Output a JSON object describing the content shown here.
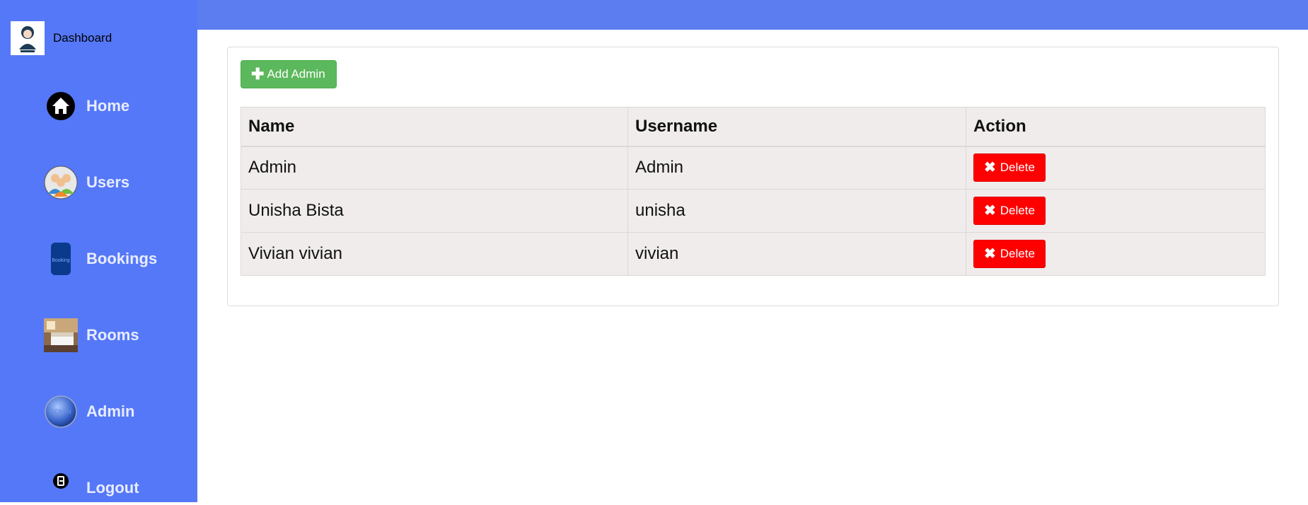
{
  "sidebar": {
    "brand": {
      "title": "Dashboard",
      "logo_icon": "admin-avatar-icon"
    },
    "items": [
      {
        "label": "Home",
        "icon": "home-icon"
      },
      {
        "label": "Users",
        "icon": "users-icon"
      },
      {
        "label": "Bookings",
        "icon": "booking-icon"
      },
      {
        "label": "Rooms",
        "icon": "room-photo-icon"
      },
      {
        "label": "Admin",
        "icon": "admin-globe-icon"
      },
      {
        "label": "Logout",
        "icon": "logout-icon"
      }
    ],
    "background_color": "#5578f8"
  },
  "topbar": {
    "color": "#5b7df0"
  },
  "main": {
    "add_button": {
      "label": "Add Admin",
      "color": "#5cb85c"
    },
    "table": {
      "headers": [
        "Name",
        "Username",
        "Action"
      ],
      "rows": [
        {
          "name": "Admin",
          "username": "Admin",
          "action": "Delete"
        },
        {
          "name": "Unisha Bista",
          "username": "unisha",
          "action": "Delete"
        },
        {
          "name": "Vivian vivian",
          "username": "vivian",
          "action": "Delete"
        }
      ],
      "delete_color": "#ff0000"
    }
  }
}
